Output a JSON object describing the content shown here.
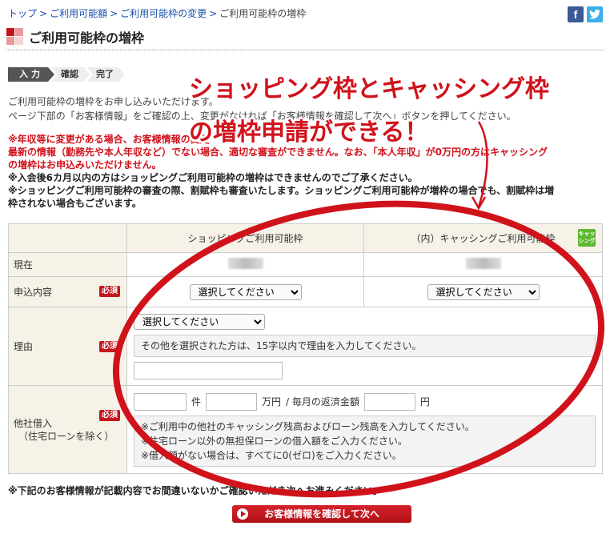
{
  "breadcrumb": {
    "items": [
      "トップ",
      "ご利用可能額",
      "ご利用可能枠の変更"
    ],
    "current": "ご利用可能枠の増枠",
    "sep": ">"
  },
  "social": {
    "facebook": "f",
    "twitter": "twitter-bird"
  },
  "page_title": "ご利用可能枠の増枠",
  "steps": [
    "入力",
    "確認",
    "完了"
  ],
  "intro": {
    "line1": "ご利用可能枠の増枠をお申し込みいただけます。",
    "line2": "ページ下部の「お客様情報」をご確認の上、変更がなければ「お客様情報を確認して次へ」ボタンを押してください。"
  },
  "warnings": {
    "w1a": "※年収等に変更がある場合、お客様情報の変更",
    "w1b": "最新の情報（勤務先や本人年収など）でない場合、適切な審査ができません。なお、「本人年収」が0万円の方はキャッシング",
    "w1c": "の増枠はお申込みいただけません。",
    "w2": "※入会後6カ月以内の方はショッピングご利用可能枠の増枠はできませんのでご了承ください。",
    "w3a": "※ショッピングご利用可能枠の審査の際、割賦枠も審査いたします。ショッピングご利用可能枠が増枠の場合でも、割賦枠は増",
    "w3b": "枠されない場合もございます。"
  },
  "table": {
    "col_shopping": "ショッピングご利用可能枠",
    "col_cashing": "（内）キャッシングご利用可能枠",
    "cashing_icon": "キャッシング",
    "row_current": "現在",
    "row_apply": "申込内容",
    "row_reason": "理由",
    "row_other_line1": "他社借入",
    "row_other_line2": "（住宅ローンを除く）",
    "required": "必須",
    "select_placeholder": "選択してください",
    "reason_note": "その他を選択された方は、15字以内で理由を入力してください。",
    "unit_count": "件",
    "unit_man_yen": "万円",
    "monthly_label": "/ 毎月の返済金額",
    "unit_yen": "円",
    "other_notes": [
      "※ご利用中の他社のキャッシング残高およびローン残高を入力してください。",
      "※住宅ローン以外の無担保ローンの借入額をご入力ください。",
      "※借入額がない場合は、すべてに0(ゼロ)をご入力ください。"
    ]
  },
  "bottom_note": "※下記のお客様情報が記載内容でお間違いないかご確認いただき次へお進みください。",
  "confirm_button": "お客様情報を確認して次へ",
  "overlay": {
    "line1": "ショッピング枠とキャッシング枠",
    "line2": "の増枠申請ができる！"
  }
}
